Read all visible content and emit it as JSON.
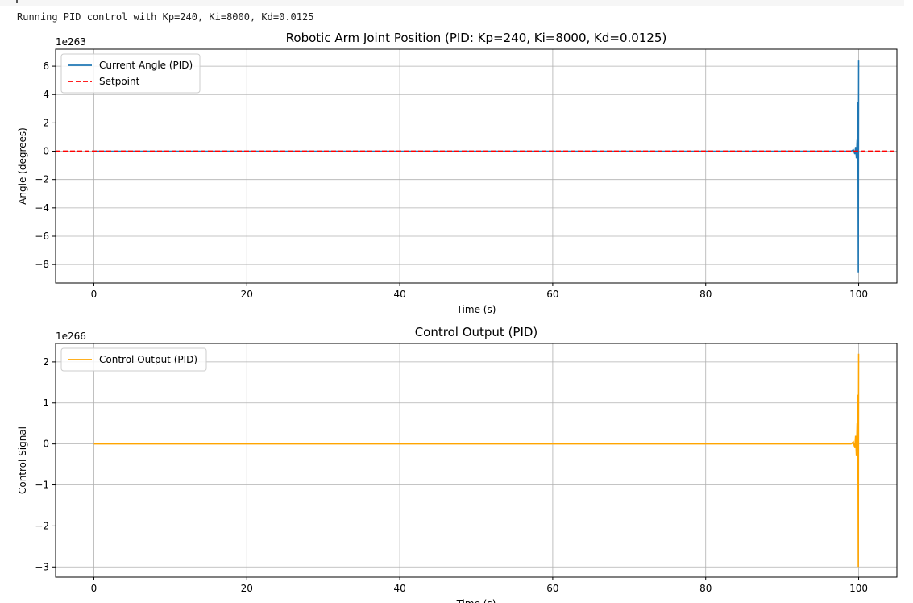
{
  "console": {
    "output": "Running PID control with Kp=240, Ki=8000, Kd=0.0125"
  },
  "chart_data": [
    {
      "type": "line",
      "title": "Robotic Arm Joint Position (PID: Kp=240, Ki=8000, Kd=0.0125)",
      "xlabel": "Time (s)",
      "ylabel": "Angle (degrees)",
      "y_offset_text": "1e263",
      "xlim": [
        -5,
        105
      ],
      "ylim": [
        -9.3,
        7.2
      ],
      "x_ticks": [
        0,
        20,
        40,
        60,
        80,
        100
      ],
      "y_ticks": [
        -8,
        -6,
        -4,
        -2,
        0,
        2,
        4,
        6
      ],
      "grid": true,
      "legend_position": "upper left",
      "series": [
        {
          "name": "Current Angle (PID)",
          "color": "#1f77b4",
          "style": "solid",
          "x": [
            0,
            99.0,
            99.3,
            99.5,
            99.6,
            99.7,
            99.8,
            99.85,
            99.9,
            99.95,
            100
          ],
          "y": [
            0,
            0,
            0.1,
            -0.2,
            0.3,
            -0.5,
            0.8,
            -1.2,
            3.5,
            -8.6,
            6.4
          ]
        },
        {
          "name": "Setpoint",
          "color": "#ff0000",
          "style": "dashed",
          "constant": 0
        }
      ]
    },
    {
      "type": "line",
      "title": "Control Output (PID)",
      "xlabel": "Time (s)",
      "ylabel": "Control Signal",
      "y_offset_text": "1e266",
      "xlim": [
        -5,
        105
      ],
      "ylim": [
        -3.25,
        2.45
      ],
      "x_ticks": [
        0,
        20,
        40,
        60,
        80,
        100
      ],
      "y_ticks": [
        -3,
        -2,
        -1,
        0,
        1,
        2
      ],
      "grid": true,
      "legend_position": "upper left",
      "series": [
        {
          "name": "Control Output (PID)",
          "color": "#ffa500",
          "style": "solid",
          "x": [
            0,
            99.0,
            99.3,
            99.5,
            99.6,
            99.7,
            99.8,
            99.85,
            99.9,
            99.95,
            100
          ],
          "y": [
            0,
            0,
            0.05,
            -0.1,
            0.2,
            -0.3,
            0.5,
            -0.9,
            1.2,
            -3.0,
            2.2
          ]
        }
      ]
    }
  ]
}
